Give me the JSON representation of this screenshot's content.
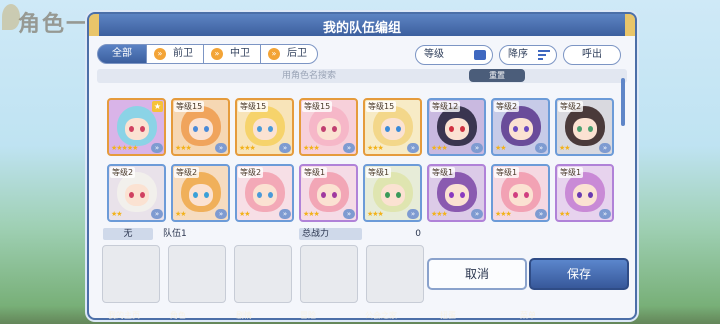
{
  "background": {
    "screen_title": "角色一览",
    "nav": [
      "我的主页",
      "角色",
      "剧情",
      "冒险",
      "公会之家",
      "扭蛋",
      "菜单"
    ]
  },
  "window": {
    "title": "我的队伍编组"
  },
  "filter": {
    "tabs": [
      "全部",
      "前卫",
      "中卫",
      "后卫"
    ],
    "sort_by": "等级",
    "order": "降序",
    "call_label": "呼出"
  },
  "search": {
    "placeholder": "用角色名搜索",
    "reset_label": "重置"
  },
  "characters": [
    {
      "level": "",
      "stars": "★★★★★"
    },
    {
      "level": "等级15",
      "stars": "★★★"
    },
    {
      "level": "等级15",
      "stars": "★★★"
    },
    {
      "level": "等级15",
      "stars": "★★★"
    },
    {
      "level": "等级15",
      "stars": "★★★"
    },
    {
      "level": "等级12",
      "stars": "★★★"
    },
    {
      "level": "等级2",
      "stars": "★★"
    },
    {
      "level": "等级2",
      "stars": "★★"
    },
    {
      "level": "等级2",
      "stars": "★★"
    },
    {
      "level": "等级2",
      "stars": "★★"
    },
    {
      "level": "等级2",
      "stars": "★★"
    },
    {
      "level": "等级1",
      "stars": "★★★"
    },
    {
      "level": "等级1",
      "stars": "★★★"
    },
    {
      "level": "等级1",
      "stars": "★★★"
    },
    {
      "level": "等级1",
      "stars": "★★★"
    },
    {
      "level": "等级1",
      "stars": "★★"
    }
  ],
  "team": {
    "slot_label": "无",
    "name": "队伍1",
    "power_label": "总战力",
    "power_value": "0"
  },
  "actions": {
    "cancel": "取消",
    "save": "保存"
  },
  "colors": {
    "frame_blue": "#4c6fa8",
    "gold_border": "#e59b3c",
    "save_blue": "#37589a"
  }
}
